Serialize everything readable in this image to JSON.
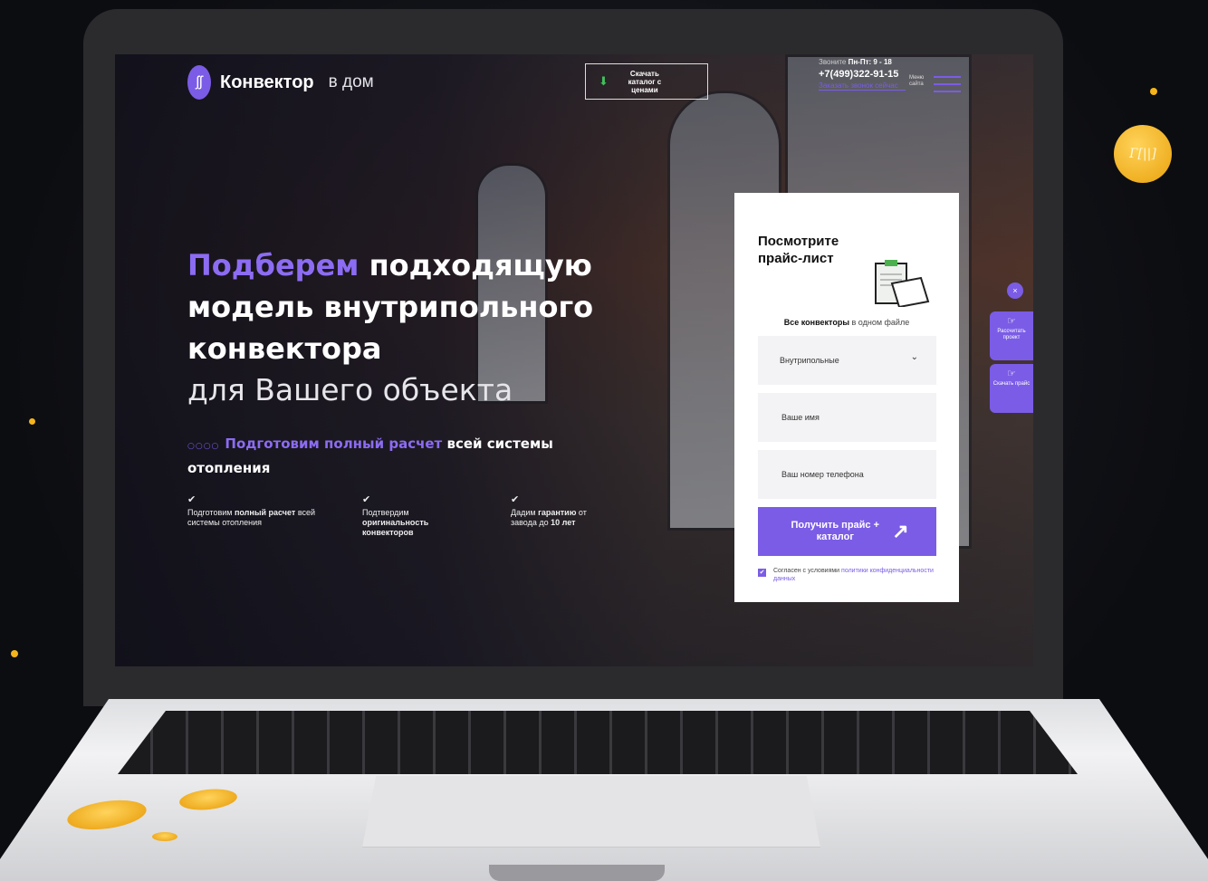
{
  "header": {
    "logo_main": "Конвектор",
    "logo_sub": "в дом",
    "catalog_button": "Скачать каталог с ценами",
    "hours_prefix": "Звоните ",
    "hours_value": "Пн-Пт: 9 - 18",
    "phone": "+7(499)322-91-15",
    "callback_link": "Заказать звонок сейчас",
    "menu_label": "Меню сайта"
  },
  "hero": {
    "title_accent_1": "Подберем",
    "title_part_1": " подходящую",
    "title_line_2": "модель внутрипольного",
    "title_accent_2": "конвектора",
    "title_line_4": "для Вашего объекта",
    "sub_accent": "Подготовим полный расчет",
    "sub_rest": " всей системы отопления"
  },
  "features": [
    {
      "pre": "Подготовим ",
      "bold": "полный расчет",
      "post": " всей системы отопления"
    },
    {
      "pre": "Подтвердим ",
      "bold": "оригинальность конвекторов",
      "post": ""
    },
    {
      "pre": "Дадим ",
      "bold": "гарантию",
      "post": " от завода до ",
      "bold2": "10 лет"
    }
  ],
  "form": {
    "title": "Посмотрите прайс-лист",
    "subtitle_bold": "Все конвекторы",
    "subtitle_rest": " в одном файле",
    "select_value": "Внутрипольные",
    "name_placeholder": "Ваше имя",
    "phone_placeholder": "Ваш номер телефона",
    "submit_label": "Получить прайс + каталог",
    "agree_text": "Согласен с условиями ",
    "agree_link": "политики конфиденциальности данных"
  },
  "side": {
    "tab1": "Рассчитать проект",
    "tab2": "Скачать прайс"
  },
  "colors": {
    "accent": "#7b5ce6",
    "coin": "#f5b41a"
  }
}
